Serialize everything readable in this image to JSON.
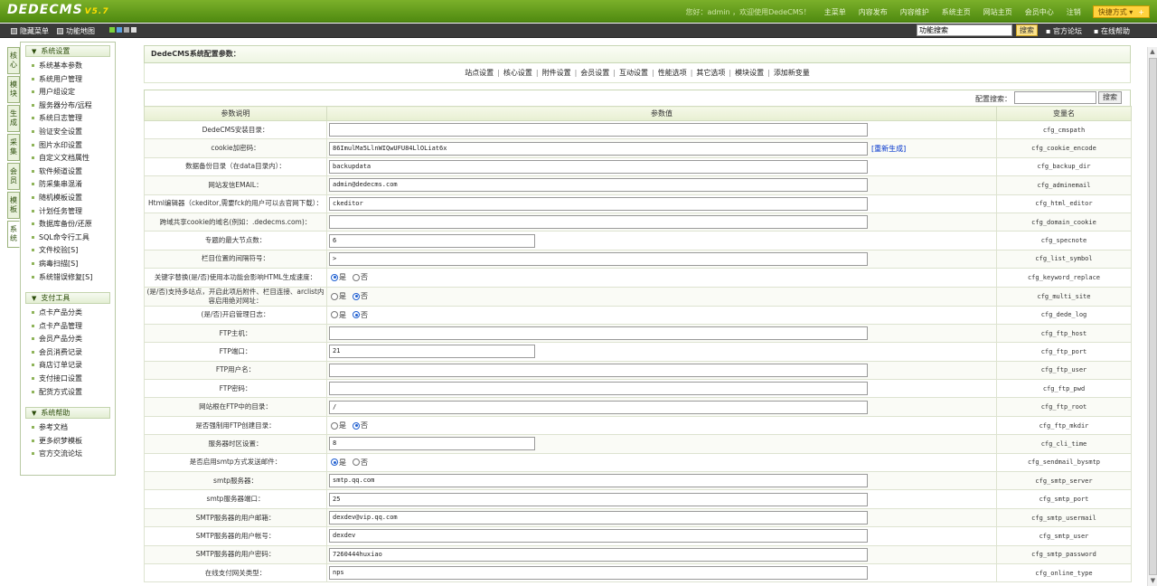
{
  "header": {
    "logo": "DEDECMS",
    "version": "V5.7",
    "greeting": "您好：admin ，欢迎使用DedeCMS！",
    "links": [
      "主菜单",
      "内容发布",
      "内容维护",
      "系统主页",
      "网站主页",
      "会员中心",
      "注销"
    ],
    "quick_btn": "快捷方式",
    "quick_plus": "+"
  },
  "toolbar": {
    "hide_menu": "隐藏菜单",
    "func_map": "功能地图",
    "search_value": "功能搜索",
    "search_btn": "搜索",
    "forum": "官方论坛",
    "help": "在线帮助"
  },
  "sidetabs": [
    "核心",
    "模块",
    "生成",
    "采集",
    "会员",
    "模板",
    "系统"
  ],
  "menu": {
    "groups": [
      {
        "title": "系统设置",
        "items": [
          "系统基本参数",
          "系统用户管理",
          "用户组设定",
          "服务器分布/远程",
          "系统日志管理",
          "验证安全设置",
          "图片水印设置",
          "自定义文档属性",
          "软件频道设置",
          "防采集串混淆",
          "随机模板设置",
          "计划任务管理",
          "数据库备份/还原",
          "SQL命令行工具",
          "文件校验[S]",
          "病毒扫描[S]",
          "系统错误修复[S]"
        ]
      },
      {
        "title": "支付工具",
        "items": [
          "点卡产品分类",
          "点卡产品管理",
          "会员产品分类",
          "会员消费记录",
          "商店订单记录",
          "支付接口设置",
          "配货方式设置"
        ]
      },
      {
        "title": "系统帮助",
        "items": [
          "参考文档",
          "更多织梦模板",
          "官方交流论坛"
        ]
      }
    ]
  },
  "main": {
    "title": "DedeCMS系统配置参数：",
    "tabs": [
      "站点设置",
      "核心设置",
      "附件设置",
      "会员设置",
      "互动设置",
      "性能选项",
      "其它选项",
      "模块设置",
      "添加新变量"
    ],
    "search_label": "配置搜索：",
    "search_btn": "搜索",
    "columns": [
      "参数说明",
      "参数值",
      "变量名"
    ],
    "regen": "[重新生成]",
    "yes": "是",
    "no": "否",
    "rows": [
      {
        "label": "DedeCMS安装目录：",
        "type": "long",
        "value": "",
        "var": "cfg_cmspath"
      },
      {
        "label": "cookie加密码：",
        "type": "long",
        "value": "86ImulMa5LlnWIQwUFU84LlOLiat6x",
        "var": "cfg_cookie_encode",
        "regen": true
      },
      {
        "label": "数据备份目录（在data目录内）：",
        "type": "long",
        "value": "backupdata",
        "var": "cfg_backup_dir"
      },
      {
        "label": "网站发信EMAIL：",
        "type": "long",
        "value": "admin@dedecms.com",
        "var": "cfg_adminemail"
      },
      {
        "label": "Html编辑器（ckeditor,需要fck的用户可以去官网下载）：",
        "type": "long",
        "value": "ckeditor",
        "var": "cfg_html_editor"
      },
      {
        "label": "跨域共享cookie的域名(例如：.dedecms.com)：",
        "type": "long",
        "value": "",
        "var": "cfg_domain_cookie"
      },
      {
        "label": "专题的最大节点数：",
        "type": "short",
        "value": "6",
        "var": "cfg_specnote"
      },
      {
        "label": "栏目位置的间隔符号：",
        "type": "long",
        "value": " >",
        "var": "cfg_list_symbol"
      },
      {
        "label": "关键字替换(是/否)使用本功能会影响HTML生成速度：",
        "type": "radio",
        "checked": "yes",
        "var": "cfg_keyword_replace"
      },
      {
        "label": "(是/否)支持多站点，开启此项后附件、栏目连接、arclist内容启用绝对网址：",
        "type": "radio",
        "checked": "no",
        "var": "cfg_multi_site"
      },
      {
        "label": "(是/否)开启管理日志：",
        "type": "radio",
        "checked": "no",
        "var": "cfg_dede_log"
      },
      {
        "label": "FTP主机：",
        "type": "long",
        "value": "",
        "var": "cfg_ftp_host"
      },
      {
        "label": "FTP端口：",
        "type": "short",
        "value": "21",
        "var": "cfg_ftp_port"
      },
      {
        "label": "FTP用户名：",
        "type": "long",
        "value": "",
        "var": "cfg_ftp_user"
      },
      {
        "label": "FTP密码：",
        "type": "long",
        "value": "",
        "var": "cfg_ftp_pwd"
      },
      {
        "label": "网站根在FTP中的目录：",
        "type": "long",
        "value": "/",
        "var": "cfg_ftp_root"
      },
      {
        "label": "是否强制用FTP创建目录：",
        "type": "radio",
        "checked": "no",
        "var": "cfg_ftp_mkdir"
      },
      {
        "label": "服务器时区设置：",
        "type": "short",
        "value": "8",
        "var": "cfg_cli_time"
      },
      {
        "label": "是否启用smtp方式发送邮件：",
        "type": "radio",
        "checked": "yes",
        "var": "cfg_sendmail_bysmtp"
      },
      {
        "label": "smtp服务器：",
        "type": "long",
        "value": "smtp.qq.com",
        "var": "cfg_smtp_server"
      },
      {
        "label": "smtp服务器端口：",
        "type": "long",
        "value": "25",
        "var": "cfg_smtp_port"
      },
      {
        "label": "SMTP服务器的用户邮箱：",
        "type": "long",
        "value": "dexdev@vip.qq.com",
        "var": "cfg_smtp_usermail"
      },
      {
        "label": "SMTP服务器的用户帐号：",
        "type": "long",
        "value": "dexdev",
        "var": "cfg_smtp_user"
      },
      {
        "label": "SMTP服务器的用户密码：",
        "type": "long",
        "value": "7260444huxiao",
        "var": "cfg_smtp_password"
      },
      {
        "label": "在线支付网关类型：",
        "type": "long",
        "value": "nps",
        "var": "cfg_online_type"
      }
    ]
  },
  "colors": {
    "header": "#5b9a16",
    "accent": "#ffd23e",
    "toolbar": "#3a3a3a"
  }
}
